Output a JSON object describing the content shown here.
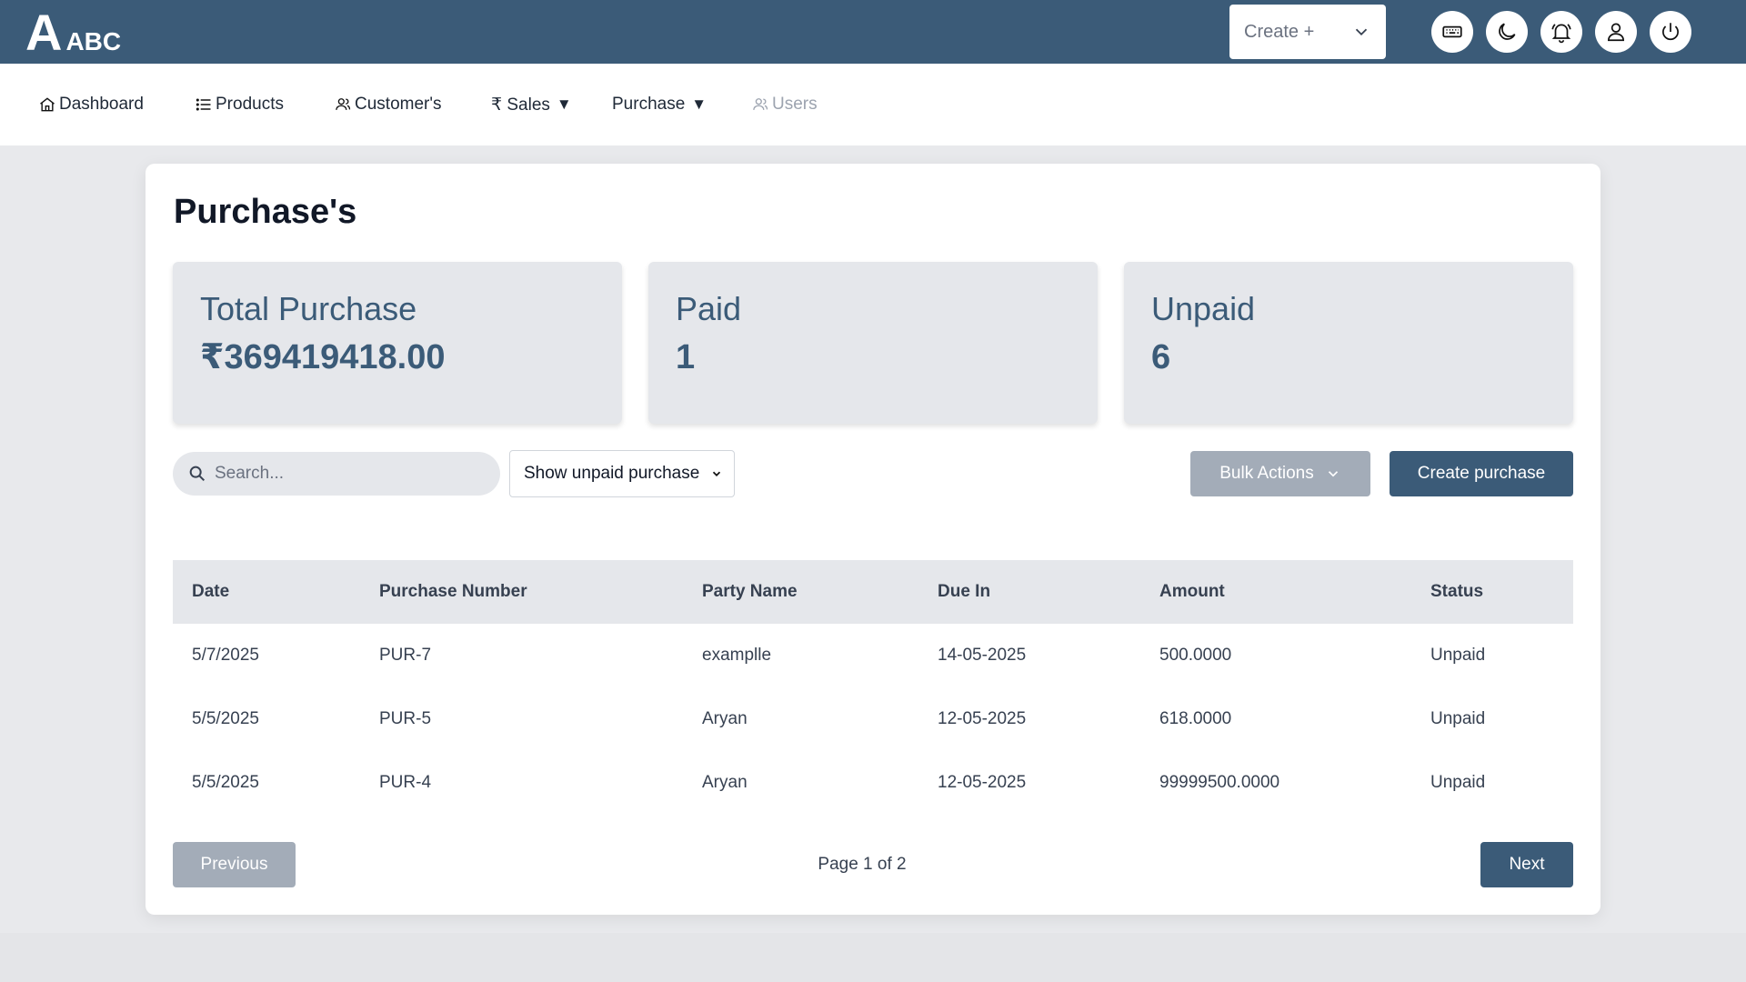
{
  "brand": {
    "logo_letter": "A",
    "logo_text": "ABC",
    "color": "#3b5b78"
  },
  "topbar": {
    "create_label": "Create +",
    "icons": [
      "keyboard-icon",
      "moon-icon",
      "bell-icon",
      "user-icon",
      "power-icon"
    ]
  },
  "nav": {
    "items": [
      {
        "label": "Dashboard",
        "icon": "home-icon"
      },
      {
        "label": "Products",
        "icon": "list-icon"
      },
      {
        "label": "Customer's",
        "icon": "users-icon"
      },
      {
        "label": "₹ Sales",
        "caret": "▼"
      },
      {
        "label": "Purchase",
        "caret": "▼"
      },
      {
        "label": "Users",
        "icon": "users-icon",
        "disabled": true
      }
    ]
  },
  "page": {
    "title": "Purchase's",
    "stats": [
      {
        "label": "Total Purchase",
        "value": "₹369419418.00"
      },
      {
        "label": "Paid",
        "value": "1"
      },
      {
        "label": "Unpaid",
        "value": "6"
      }
    ],
    "search_placeholder": "Search...",
    "filter_value": "Show unpaid purchase",
    "bulk_label": "Bulk Actions",
    "create_purchase_label": "Create purchase"
  },
  "table": {
    "headers": [
      "Date",
      "Purchase Number",
      "Party Name",
      "Due In",
      "Amount",
      "Status"
    ],
    "rows": [
      [
        "5/7/2025",
        "PUR-7",
        "examplle",
        "14-05-2025",
        "500.0000",
        "Unpaid"
      ],
      [
        "5/5/2025",
        "PUR-5",
        "Aryan",
        "12-05-2025",
        "618.0000",
        "Unpaid"
      ],
      [
        "5/5/2025",
        "PUR-4",
        "Aryan",
        "12-05-2025",
        "99999500.0000",
        "Unpaid"
      ]
    ]
  },
  "pagination": {
    "previous": "Previous",
    "info": "Page 1 of 2",
    "next": "Next"
  }
}
